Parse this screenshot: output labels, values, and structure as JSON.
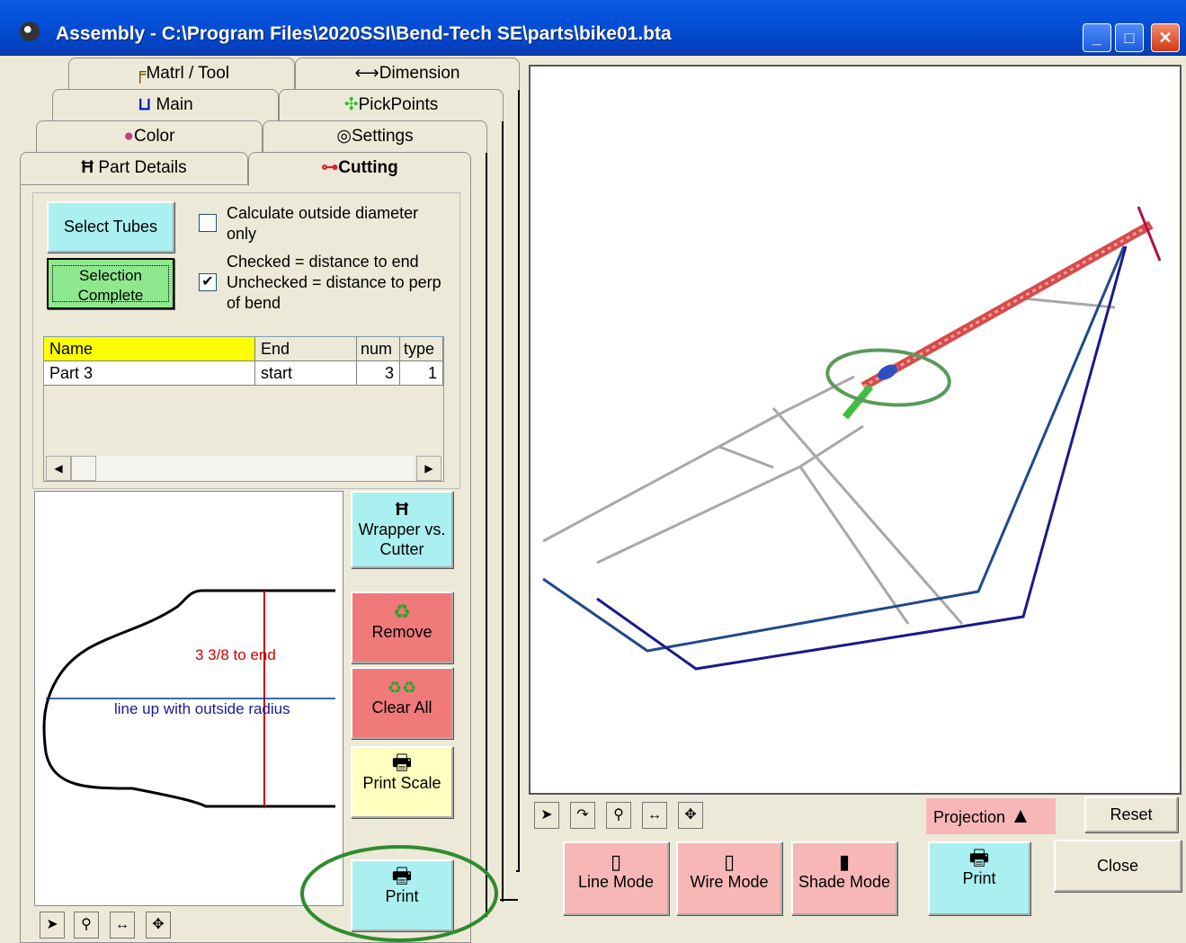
{
  "window": {
    "title": "Assembly - C:\\Program Files\\2020SSI\\Bend-Tech SE\\parts\\bike01.bta",
    "controls": [
      "minimize",
      "maximize",
      "close"
    ]
  },
  "tabs": {
    "row1": [
      "Matrl / Tool",
      "Dimension"
    ],
    "row2": [
      "Main",
      "PickPoints"
    ],
    "row3": [
      "Color",
      "Settings"
    ],
    "row4": [
      "Part Details",
      "Cutting"
    ],
    "active": "Cutting"
  },
  "cutting": {
    "select_tubes": "Select Tubes",
    "selection_complete": "Selection Complete",
    "calc_od_label": "Calculate outside diameter only",
    "calc_od_checked": false,
    "distance_label": "Checked = distance to end Unchecked = distance to perp of bend",
    "distance_checked": true,
    "table": {
      "headers": [
        "Name",
        "End",
        "num",
        "type"
      ],
      "rows": [
        [
          "Part 3",
          "start",
          "3",
          "1"
        ]
      ]
    },
    "wrapper_btn": "Wrapper vs. Cutter",
    "remove_btn": "Remove",
    "clear_all_btn": "Clear All",
    "print_scale_btn": "Print Scale",
    "print_btn": "Print",
    "pattern": {
      "dim_text": "3  3/8 to end",
      "line_text": "line up with outside radius"
    }
  },
  "viewport": {
    "projection_label": "Projection",
    "reset_btn": "Reset",
    "close_btn": "Close",
    "line_mode": "Line Mode",
    "wire_mode": "Wire Mode",
    "shade_mode": "Shade Mode",
    "print_btn": "Print"
  },
  "colors": {
    "titlebar": "#0550d8",
    "highlight_ring": "#2e8b2e",
    "header_yellow": "#ffff00"
  }
}
